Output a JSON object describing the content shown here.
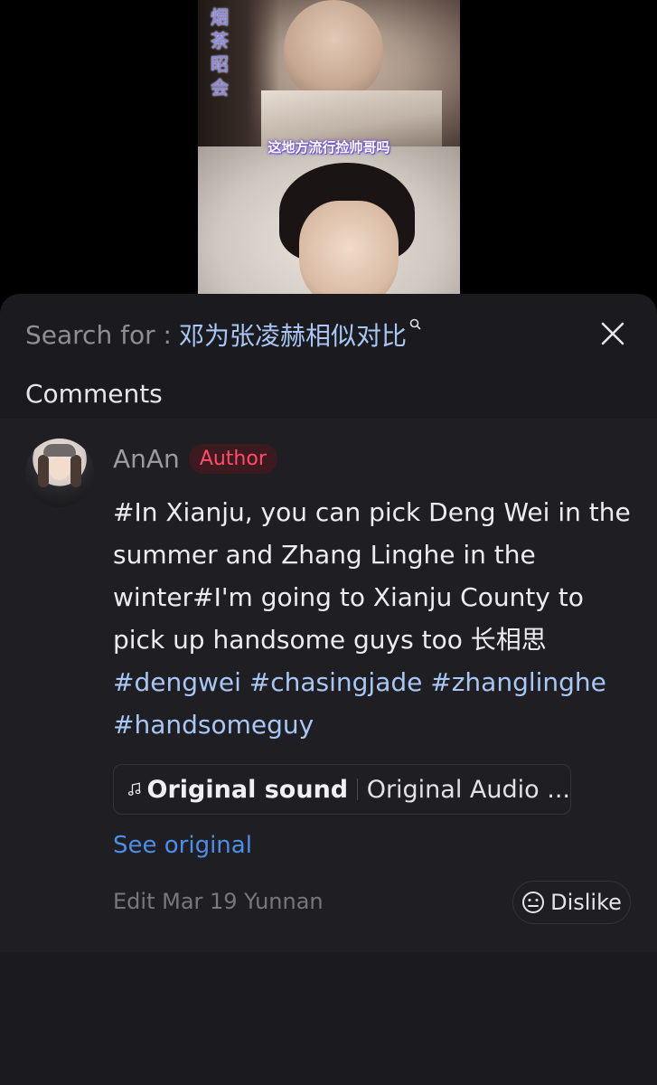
{
  "video": {
    "vertical_title": "烟茶昭会",
    "subtitle": "这地方流行捡帅哥吗"
  },
  "search": {
    "prefix": "Search for :",
    "query": "邓为张凌赫相似对比"
  },
  "comments_title": "Comments",
  "comment": {
    "author_name": "AnAn",
    "author_badge": "Author",
    "text_plain": "#In Xianju, you can pick Deng Wei in the summer and Zhang Linghe in the winter#I'm going to Xianju County to pick up handsome guys too 长相思",
    "hashtags": "#dengwei #chasingjade #zhanglinghe #handsomeguy",
    "sound_name": "Original sound",
    "sound_audio": "Original Audio ...",
    "see_original": "See original",
    "meta": "Edit Mar 19 Yunnan",
    "dislike_label": "Dislike"
  },
  "colors": {
    "sheet_bg": "#1b1b1f",
    "link_blue": "#4d8fe8",
    "hashtag_blue": "#a9c7f4",
    "author_red": "#ff4d68"
  },
  "icons": [
    "search-icon",
    "close-icon",
    "music-note-icon",
    "dislike-face-icon"
  ]
}
